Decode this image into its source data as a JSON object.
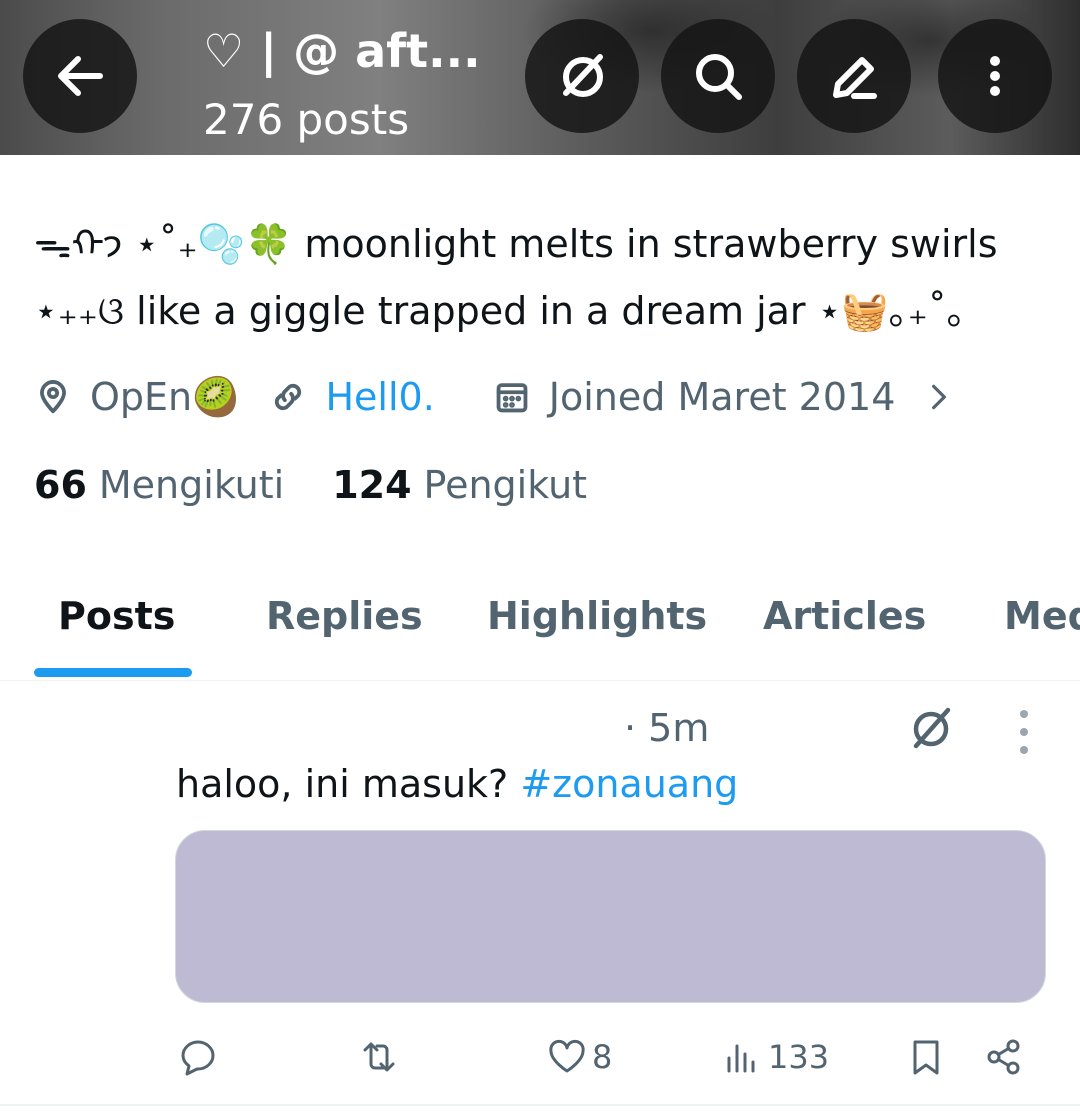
{
  "header": {
    "title": "♡ | @ aft...",
    "subtitle": "276 posts"
  },
  "bio": {
    "line1": "ᯓᡣ𐭩 ⋆˚₊🫧🍀 moonlight melts in strawberry swirls",
    "line2": "⋆₊₊ଓ like a giggle trapped in a dream jar ⋆🧺｡₊˚｡"
  },
  "meta": {
    "location": "OpEn🥝",
    "link": "Hell0.",
    "joined": "Joined Maret 2014"
  },
  "follow": {
    "following_count": "66",
    "following_label": "Mengikuti",
    "followers_count": "124",
    "followers_label": "Pengikut"
  },
  "tabs": [
    {
      "label": "Posts"
    },
    {
      "label": "Replies"
    },
    {
      "label": "Highlights"
    },
    {
      "label": "Articles"
    },
    {
      "label": "Media"
    }
  ],
  "post": {
    "time": "· 5m",
    "text": "haloo, ini masuk? ",
    "hashtag": "#zonauang",
    "likes": "8",
    "views": "133",
    "media_color": "#bebad3"
  },
  "colors": {
    "accent": "#1d9bf0",
    "secondary_text": "#536471",
    "primary_text": "#0f1419"
  }
}
